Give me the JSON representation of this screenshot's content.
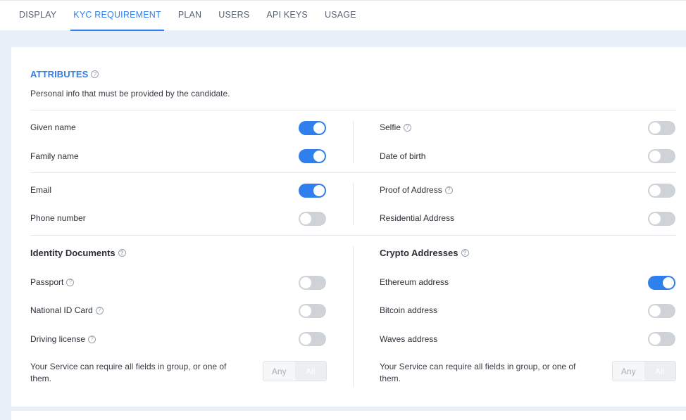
{
  "tabs": [
    {
      "label": "DISPLAY"
    },
    {
      "label": "KYC REQUIREMENT"
    },
    {
      "label": "PLAN"
    },
    {
      "label": "USERS"
    },
    {
      "label": "API KEYS"
    },
    {
      "label": "USAGE"
    }
  ],
  "active_tab": "KYC REQUIREMENT",
  "attributes": {
    "title": "ATTRIBUTES",
    "subtitle": "Personal info that must be provided by the candidate."
  },
  "fields": {
    "given_name": {
      "label": "Given name",
      "enabled": true
    },
    "family_name": {
      "label": "Family name",
      "enabled": true
    },
    "selfie": {
      "label": "Selfie",
      "enabled": false
    },
    "date_of_birth": {
      "label": "Date of birth",
      "enabled": false
    },
    "email": {
      "label": "Email",
      "enabled": true
    },
    "phone_number": {
      "label": "Phone number",
      "enabled": false
    },
    "proof_of_address": {
      "label": "Proof of Address",
      "enabled": false
    },
    "residential_address": {
      "label": "Residential Address",
      "enabled": false
    }
  },
  "identity_documents": {
    "title": "Identity Documents",
    "items": [
      {
        "label": "Passport",
        "enabled": false
      },
      {
        "label": "National ID Card",
        "enabled": false
      },
      {
        "label": "Driving license",
        "enabled": false
      }
    ],
    "note": "Your Service can require all fields in group, or one of them.",
    "any_label": "Any",
    "all_label": "All",
    "selected": "All"
  },
  "crypto_addresses": {
    "title": "Crypto Addresses",
    "items": [
      {
        "label": "Ethereum address",
        "enabled": true
      },
      {
        "label": "Bitcoin address",
        "enabled": false
      },
      {
        "label": "Waves address",
        "enabled": false
      }
    ],
    "note": "Your Service can require all fields in group, or one of them.",
    "any_label": "Any",
    "all_label": "All",
    "selected": "All"
  },
  "colors": {
    "accent": "#2f80ed",
    "toggle_off": "#cfd3d8",
    "background": "#e9eff8"
  },
  "icons": {
    "help": "question-circle-icon"
  }
}
